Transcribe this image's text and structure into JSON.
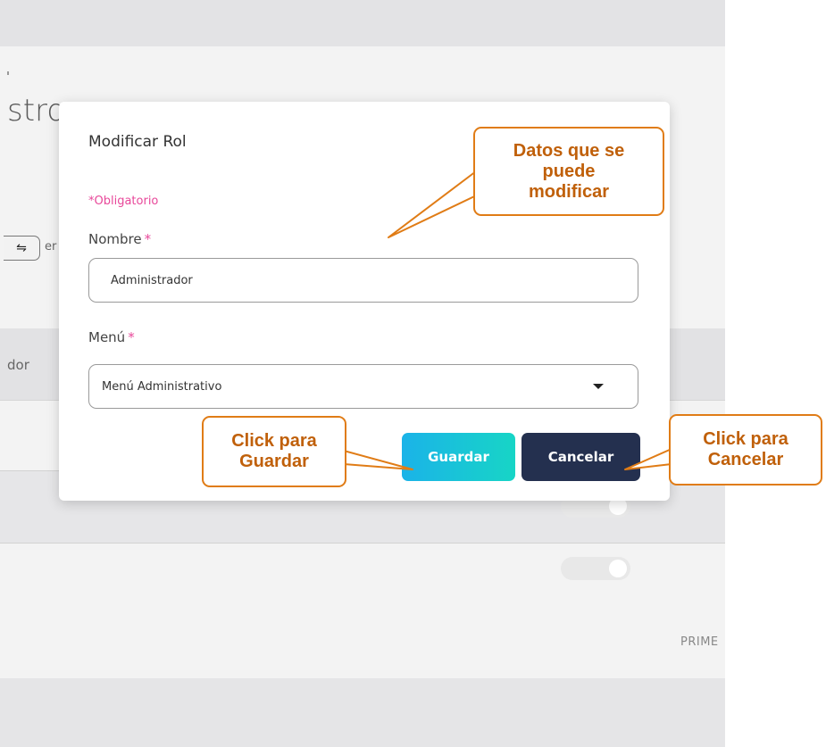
{
  "background": {
    "title": "stro",
    "sort_icon": "sort-icon",
    "sort_suffix": "er",
    "column_header": "dor",
    "footer_text": "PRIME"
  },
  "modal": {
    "title": "Modificar Rol",
    "required_note": "Obligatorio",
    "required_marker": "*",
    "fields": {
      "nombre": {
        "label": "Nombre",
        "value": "Administrador"
      },
      "menu": {
        "label": "Menú",
        "selected": "Menú Administrativo"
      }
    },
    "buttons": {
      "save": "Guardar",
      "cancel": "Cancelar"
    }
  },
  "annotations": {
    "data": [
      "Datos que se",
      "puede",
      "modificar"
    ],
    "save": [
      "Click para",
      "Guardar"
    ],
    "cancel": [
      "Click para",
      "Cancelar"
    ]
  },
  "colors": {
    "accent_required": "#e8489a",
    "save_gradient_start": "#1bb3e8",
    "save_gradient_end": "#17d5c6",
    "cancel": "#24304f",
    "annotation": "#e07c16"
  }
}
